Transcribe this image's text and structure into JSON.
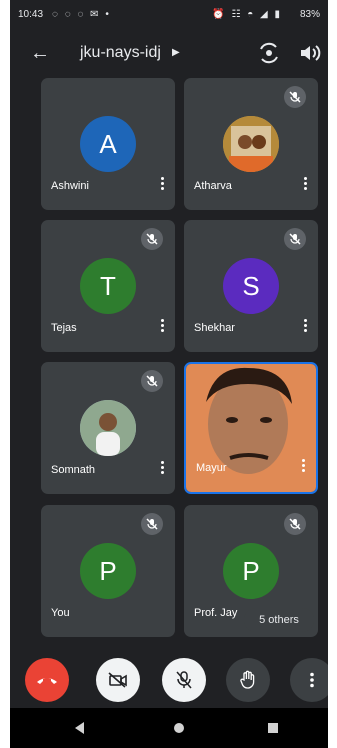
{
  "status": {
    "time": "10:43",
    "battery": "83%"
  },
  "header": {
    "meeting_code": "jku-nays-idj"
  },
  "participants": [
    {
      "name": "Ashwini",
      "initial": "A",
      "color": "#1e66b8",
      "muted": false
    },
    {
      "name": "Atharva",
      "photo": true,
      "muted": true
    },
    {
      "name": "Tejas",
      "initial": "T",
      "color": "#2e7d2e",
      "muted": true
    },
    {
      "name": "Shekhar",
      "initial": "S",
      "color": "#5b2bbf",
      "muted": true
    },
    {
      "name": "Somnath",
      "photo": true,
      "muted": true
    },
    {
      "name": "Mayur",
      "video": true,
      "muted": false,
      "active_speaker": true
    },
    {
      "name": "You",
      "initial": "P",
      "color": "#2e7d2e",
      "muted": true
    },
    {
      "name": "Prof. Jay",
      "initial": "P",
      "color": "#2e7d2e",
      "muted": true
    }
  ],
  "others_badge": "5 others",
  "controls": {
    "end_call_color": "#ea4335",
    "camera_state": "off",
    "mic_state": "muted"
  }
}
